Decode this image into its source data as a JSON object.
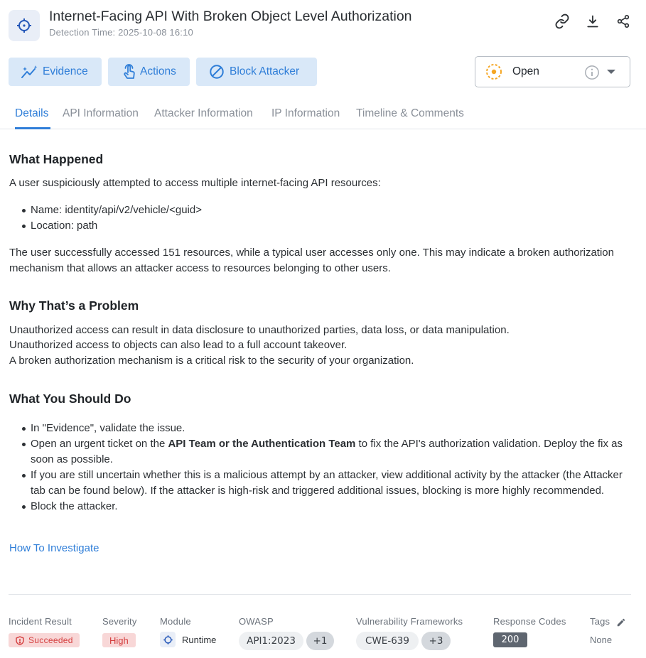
{
  "header": {
    "title": "Internet-Facing API With Broken Object Level Authorization",
    "subtitle": "Detection Time: 2025-10-08 16:10",
    "icon": "crosshair-icon",
    "actions": [
      {
        "icon": "link-icon"
      },
      {
        "icon": "download-icon"
      },
      {
        "icon": "share-icon"
      }
    ]
  },
  "toolbar": {
    "evidence_label": "Evidence",
    "actions_label": "Actions",
    "block_label": "Block Attacker"
  },
  "status": {
    "label": "Open",
    "color": "#f5a623"
  },
  "tabs": [
    {
      "label": "Details",
      "active": true
    },
    {
      "label": "API Information"
    },
    {
      "label": "Attacker Information"
    },
    {
      "label": "IP Information"
    },
    {
      "label": "Timeline & Comments"
    }
  ],
  "details": {
    "what_happened": {
      "heading": "What Happened",
      "intro": "A user suspiciously attempted to access multiple internet-facing API resources:",
      "bullets": [
        "Name: identity/api/v2/vehicle/<guid>",
        "Location: path"
      ],
      "summary": "The user successfully accessed 151 resources, while a typical user accesses only one. This may indicate a broken authorization mechanism that allows an attacker access to resources belonging to other users."
    },
    "why_problem": {
      "heading": "Why That’s a Problem",
      "line1": "Unauthorized access can result in data disclosure to unauthorized parties, data loss, or data manipulation.",
      "line2": "Unauthorized access to objects can also lead to a full account takeover.",
      "line3": "A broken authorization mechanism is a critical risk to the security of your organization."
    },
    "what_to_do": {
      "heading": "What You Should Do",
      "b1": "In \"Evidence\", validate the issue.",
      "b2_pre": "Open an urgent ticket on the ",
      "b2_bold": "API Team or the Authentication Team",
      "b2_post": " to fix the API's authorization validation. Deploy the fix as soon as possible.",
      "b3": "If you are still uncertain whether this is a malicious attempt by an attacker, view additional activity by the attacker (the Attacker tab can be found below). If the attacker is high-risk and triggered additional issues, blocking is more highly recommended.",
      "b4": "Block the attacker."
    },
    "investigate_link": "How To Investigate"
  },
  "meta": {
    "incident_result": {
      "label": "Incident Result",
      "value": "Succeeded"
    },
    "severity": {
      "label": "Severity",
      "value": "High"
    },
    "module": {
      "label": "Module",
      "value": "Runtime"
    },
    "owasp": {
      "label": "OWASP",
      "value": "API1:2023",
      "more": "+1"
    },
    "vuln": {
      "label": "Vulnerability Frameworks",
      "value": "CWE-639",
      "more": "+3"
    },
    "response_codes": {
      "label": "Response Codes",
      "value": "200"
    },
    "tags": {
      "label": "Tags",
      "value": "None"
    }
  }
}
